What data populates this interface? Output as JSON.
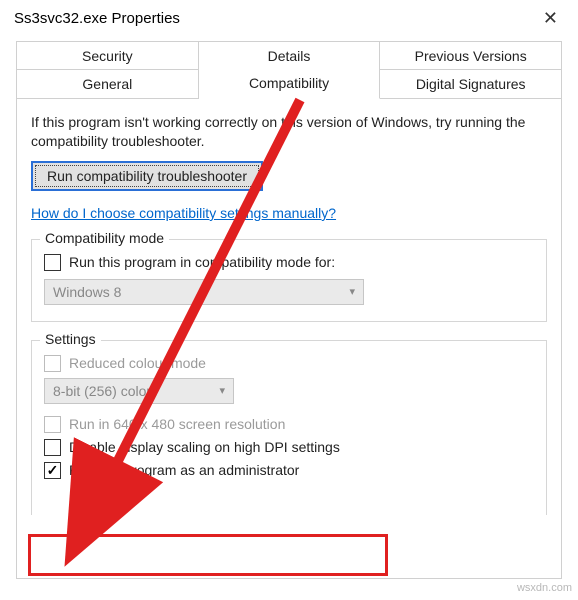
{
  "window": {
    "title": "Ss3svc32.exe Properties"
  },
  "tabs": {
    "row1": [
      "Security",
      "Details",
      "Previous Versions"
    ],
    "row2": [
      "General",
      "Compatibility",
      "Digital Signatures"
    ],
    "active": "Compatibility"
  },
  "intro": "If this program isn't working correctly on this version of Windows, try running the compatibility troubleshooter.",
  "troubleshoot_button": "Run compatibility troubleshooter",
  "help_link": "How do I choose compatibility settings manually?",
  "compat_mode": {
    "legend": "Compatibility mode",
    "checkbox_label": "Run this program in compatibility mode for:",
    "select_value": "Windows 8"
  },
  "settings": {
    "legend": "Settings",
    "reduced_colour": "Reduced colour mode",
    "colour_select": "8-bit (256) colour",
    "low_res": "Run in 640 x 480 screen resolution",
    "disable_dpi": "Disable display scaling on high DPI settings",
    "run_admin": "Run this program as an administrator"
  },
  "watermark": "wsxdn.com"
}
